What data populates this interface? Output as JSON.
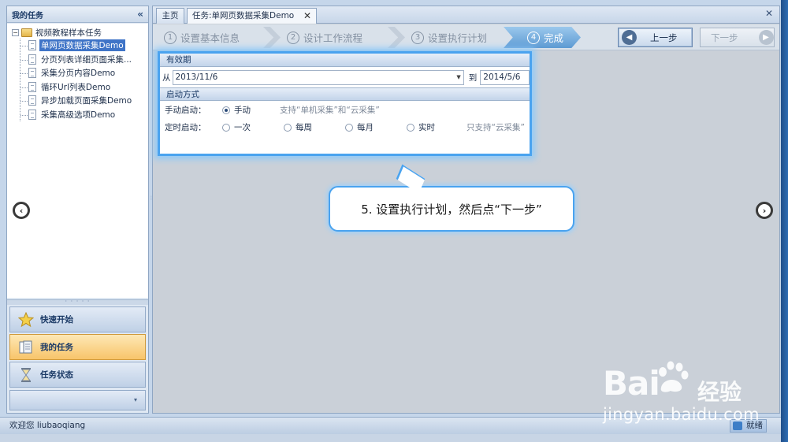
{
  "left_panel": {
    "title": "我的任务",
    "collapse_glyph": "«",
    "tree": {
      "root_label": "视频教程样本任务",
      "expander": "−",
      "items": [
        {
          "label": "单网页数据采集Demo",
          "selected": true
        },
        {
          "label": "分页列表详细页面采集..."
        },
        {
          "label": "采集分页内容Demo"
        },
        {
          "label": "循环Url列表Demo"
        },
        {
          "label": "异步加载页面采集Demo"
        },
        {
          "label": "采集高级选项Demo"
        }
      ]
    },
    "splitter_glyph": "· · · · ·",
    "nav": [
      {
        "label": "快速开始",
        "icon": "star-icon"
      },
      {
        "label": "我的任务",
        "icon": "tasks-icon",
        "active": true
      },
      {
        "label": "任务状态",
        "icon": "hourglass-icon"
      }
    ],
    "overflow_glyph": "▾"
  },
  "tabs": {
    "home": "主页",
    "task": "任务:单网页数据采集Demo",
    "close_glyph": "✕"
  },
  "wizard": {
    "steps": [
      {
        "num": "1",
        "label": "设置基本信息"
      },
      {
        "num": "2",
        "label": "设计工作流程"
      },
      {
        "num": "3",
        "label": "设置执行计划"
      },
      {
        "num": "4",
        "label": "完成",
        "active": true
      }
    ],
    "prev_label": "上一步",
    "next_label": "下一步"
  },
  "form": {
    "validity_title": "有效期",
    "from_label": "从",
    "from_value": "2013/11/6",
    "to_label": "到",
    "to_value": "2014/5/6",
    "start_title": "启动方式",
    "manual_label": "手动启动：",
    "manual_option": "手动",
    "manual_hint": "支持“单机采集”和“云采集”",
    "scheduled_label": "定时启动：",
    "schedule_options": [
      "一次",
      "每周",
      "每月",
      "实时"
    ],
    "scheduled_hint": "只支持“云采集”"
  },
  "callout": {
    "text": "5. 设置执行计划，然后点“下一步”"
  },
  "status": {
    "welcome": "欢迎您 liubaoqiang",
    "ready": "就绪"
  },
  "watermark": {
    "logo_text": "Bai",
    "logo_suffix": "经验",
    "url": "jingyan.baidu.com"
  },
  "colors": {
    "accent": "#4aa3ef",
    "selection": "#3f74c7",
    "active_nav": "#f8c46a"
  }
}
